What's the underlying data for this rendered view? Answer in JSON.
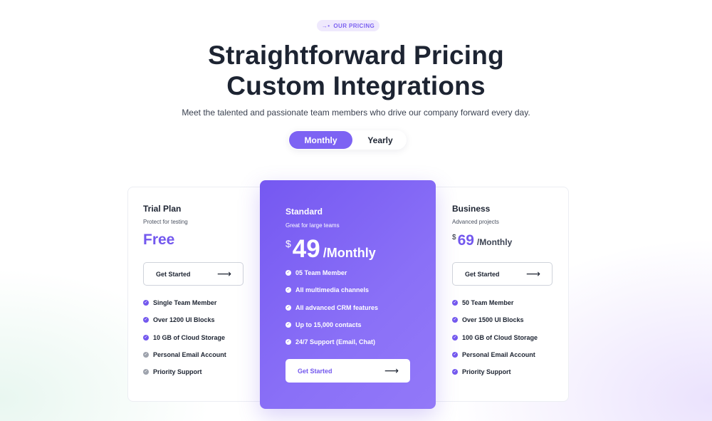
{
  "eyebrow": {
    "icon": "arrow-right-dots-icon",
    "text": "OUR PRICING"
  },
  "heading": {
    "line1": "Straightforward Pricing",
    "line2": "Custom Integrations"
  },
  "subtitle": "Meet the talented and passionate team members who drive our company forward every day.",
  "billing_toggle": {
    "monthly": "Monthly",
    "yearly": "Yearly",
    "selected": "Monthly"
  },
  "colors": {
    "accent": "#7358ee",
    "featured_gradient_start": "#7558f1",
    "featured_gradient_end": "#9278f8"
  },
  "plans": [
    {
      "name": "Trial Plan",
      "description": "Protect for testing",
      "price": "Free",
      "cta": "Get Started",
      "features": [
        {
          "text": "Single Team Member",
          "included": true
        },
        {
          "text": "Over 1200 UI Blocks",
          "included": true
        },
        {
          "text": "10 GB of Cloud Storage",
          "included": true
        },
        {
          "text": "Personal Email Account",
          "included": false
        },
        {
          "text": "Priority Support",
          "included": false
        }
      ]
    },
    {
      "name": "Standard",
      "description": "Great for large teams",
      "currency": "$",
      "amount": "49",
      "period": "/Monthly",
      "cta": "Get Started",
      "featured": true,
      "features": [
        {
          "text": "05 Team Member",
          "included": true
        },
        {
          "text": "All multimedia channels",
          "included": true
        },
        {
          "text": "All advanced CRM features",
          "included": true
        },
        {
          "text": "Up to 15,000 contacts",
          "included": true
        },
        {
          "text": "24/7 Support (Email, Chat)",
          "included": true
        }
      ]
    },
    {
      "name": "Business",
      "description": "Advanced projects",
      "currency": "$",
      "amount": "69",
      "period": "/Monthly",
      "cta": "Get Started",
      "features": [
        {
          "text": "50 Team Member",
          "included": true
        },
        {
          "text": "Over 1500 UI Blocks",
          "included": true
        },
        {
          "text": "100 GB of Cloud Storage",
          "included": true
        },
        {
          "text": "Personal Email Account",
          "included": true
        },
        {
          "text": "Priority Support",
          "included": true
        }
      ]
    }
  ]
}
